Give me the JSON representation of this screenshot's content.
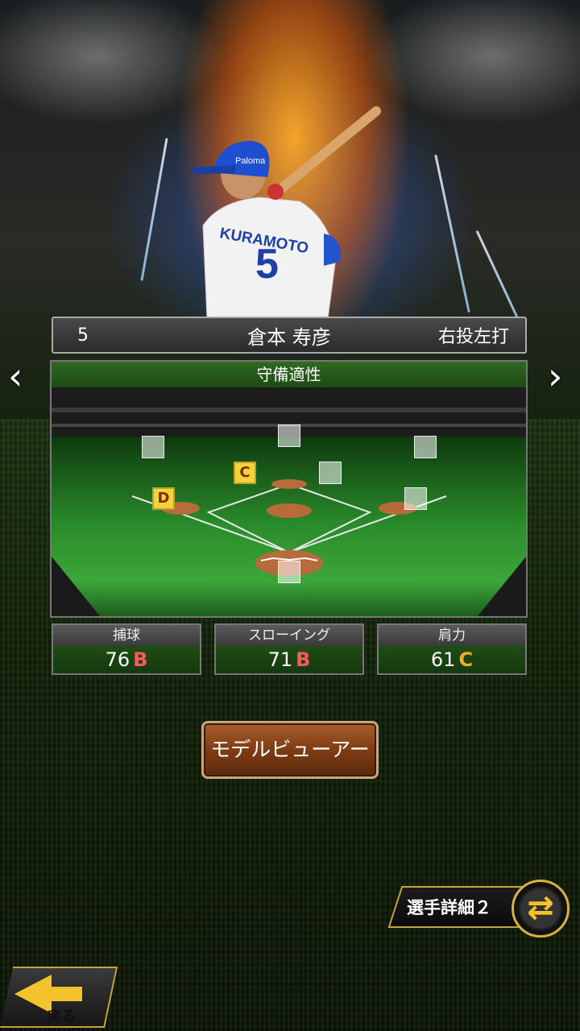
{
  "player": {
    "number": "5",
    "name": "倉本 寿彦",
    "handedness": "右投左打",
    "jersey_name": "KURAMOTO",
    "jersey_number": "5"
  },
  "defense": {
    "title": "守備適性",
    "positions": [
      {
        "grade": "C"
      },
      {
        "grade": "D"
      }
    ]
  },
  "stats": [
    {
      "label": "捕球",
      "value": "76",
      "grade": "B",
      "grade_color": "#ff5a5a"
    },
    {
      "label": "スローイング",
      "value": "71",
      "grade": "B",
      "grade_color": "#ff5a5a"
    },
    {
      "label": "肩力",
      "value": "61",
      "grade": "C",
      "grade_color": "#f0b020"
    }
  ],
  "buttons": {
    "model_viewer": "モデルビューアー",
    "player_details_2": "選手詳細２",
    "back": "戻る"
  },
  "nav": {
    "prev": "‹",
    "next": "›"
  },
  "colors": {
    "gold": "#f4c22a",
    "panel_green": "#1f4d14"
  }
}
